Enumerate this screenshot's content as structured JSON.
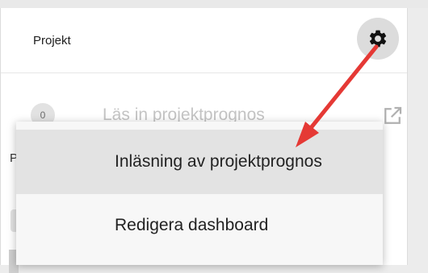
{
  "card": {
    "title": "Projekt"
  },
  "row": {
    "count": "0",
    "label": "Läs in projektprognos"
  },
  "below": {
    "partial_text": "P"
  },
  "menu": {
    "items": [
      {
        "label": "Inläsning av projektprognos",
        "highlighted": true
      },
      {
        "label": "Redigera dashboard",
        "highlighted": false
      }
    ]
  },
  "annotation": {
    "arrow_color": "#e53935"
  },
  "icons": {
    "settings": "gear-icon",
    "open_external": "open-in-new-icon"
  }
}
